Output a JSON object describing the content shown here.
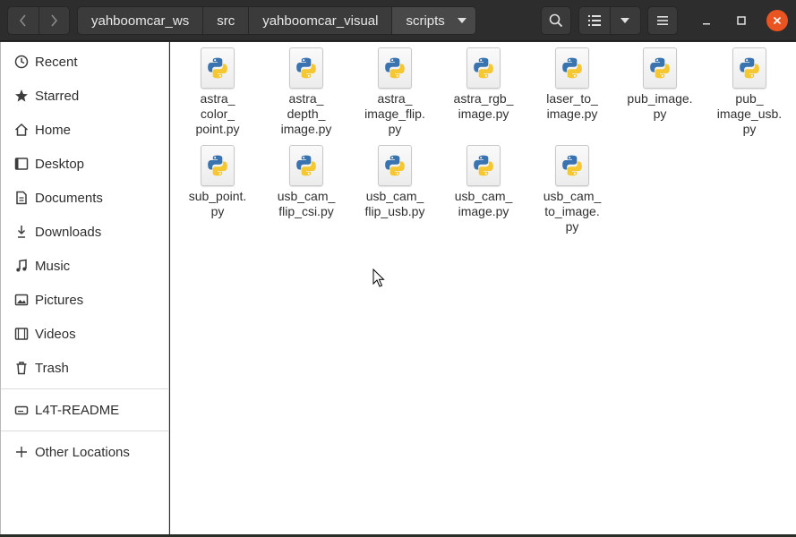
{
  "nav": {
    "back_icon": "chevron-left-icon",
    "forward_icon": "chevron-right-icon"
  },
  "path": [
    "yahboomcar_ws",
    "src",
    "yahboomcar_visual",
    "scripts"
  ],
  "toolbar": {
    "search_icon": "search-icon",
    "view_icon": "list-view-icon",
    "menu_icon": "hamburger-menu-icon"
  },
  "window": {
    "close_color": "#e95420"
  },
  "sidebar": {
    "places": [
      {
        "label": "Recent",
        "icon": "clock-icon"
      },
      {
        "label": "Starred",
        "icon": "star-icon"
      },
      {
        "label": "Home",
        "icon": "home-icon"
      },
      {
        "label": "Desktop",
        "icon": "desktop-icon"
      },
      {
        "label": "Documents",
        "icon": "document-icon"
      },
      {
        "label": "Downloads",
        "icon": "download-icon"
      },
      {
        "label": "Music",
        "icon": "music-icon"
      },
      {
        "label": "Pictures",
        "icon": "pictures-icon"
      },
      {
        "label": "Videos",
        "icon": "video-icon"
      },
      {
        "label": "Trash",
        "icon": "trash-icon"
      }
    ],
    "devices": [
      {
        "label": "L4T-README",
        "icon": "drive-icon"
      }
    ],
    "other": {
      "label": "Other Locations",
      "icon": "plus-icon"
    }
  },
  "files": [
    {
      "name": "astra_\ncolor_\npoint.py"
    },
    {
      "name": "astra_\ndepth_\nimage.py"
    },
    {
      "name": "astra_\nimage_flip.\npy"
    },
    {
      "name": "astra_rgb_\nimage.py"
    },
    {
      "name": "laser_to_\nimage.py"
    },
    {
      "name": "pub_image.\npy"
    },
    {
      "name": "pub_\nimage_usb.\npy"
    },
    {
      "name": "sub_point.\npy"
    },
    {
      "name": "usb_cam_\nflip_csi.py"
    },
    {
      "name": "usb_cam_\nflip_usb.py"
    },
    {
      "name": "usb_cam_\nimage.py"
    },
    {
      "name": "usb_cam_\nto_image.\npy"
    }
  ]
}
